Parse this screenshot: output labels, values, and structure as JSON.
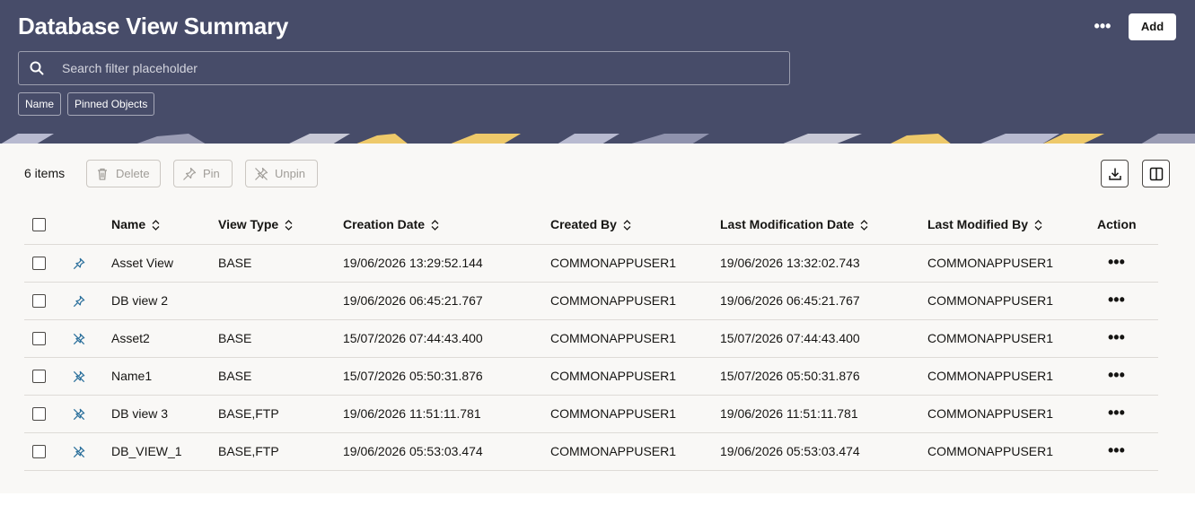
{
  "header": {
    "title": "Database View Summary",
    "more_label": "•••",
    "add_label": "Add",
    "search_placeholder": "Search filter placeholder",
    "chips": [
      "Name",
      "Pinned Objects"
    ]
  },
  "toolbar": {
    "items_count": "6 items",
    "delete_label": "Delete",
    "pin_label": "Pin",
    "unpin_label": "Unpin"
  },
  "table": {
    "columns": [
      "Name",
      "View Type",
      "Creation Date",
      "Created By",
      "Last Modification Date",
      "Last Modified By",
      "Action"
    ],
    "rows": [
      {
        "pin": "pinned",
        "name": "Asset View",
        "view_type": "BASE",
        "creation_date": "19/06/2026 13:29:52.144",
        "created_by": "COMMONAPPUSER1",
        "last_mod_date": "19/06/2026 13:32:02.743",
        "last_mod_by": "COMMONAPPUSER1",
        "action": "•••"
      },
      {
        "pin": "pinned",
        "name": "DB view 2",
        "view_type": "",
        "creation_date": "19/06/2026 06:45:21.767",
        "created_by": "COMMONAPPUSER1",
        "last_mod_date": "19/06/2026 06:45:21.767",
        "last_mod_by": "COMMONAPPUSER1",
        "action": "•••"
      },
      {
        "pin": "unpinned",
        "name": "Asset2",
        "view_type": "BASE",
        "creation_date": "15/07/2026 07:44:43.400",
        "created_by": "COMMONAPPUSER1",
        "last_mod_date": "15/07/2026 07:44:43.400",
        "last_mod_by": "COMMONAPPUSER1",
        "action": "•••"
      },
      {
        "pin": "unpinned",
        "name": "Name1",
        "view_type": "BASE",
        "creation_date": "15/07/2026 05:50:31.876",
        "created_by": "COMMONAPPUSER1",
        "last_mod_date": "15/07/2026 05:50:31.876",
        "last_mod_by": "COMMONAPPUSER1",
        "action": "•••"
      },
      {
        "pin": "unpinned",
        "name": "DB view 3",
        "view_type": "BASE,FTP",
        "creation_date": "19/06/2026 11:51:11.781",
        "created_by": "COMMONAPPUSER1",
        "last_mod_date": "19/06/2026 11:51:11.781",
        "last_mod_by": "COMMONAPPUSER1",
        "action": "•••"
      },
      {
        "pin": "unpinned",
        "name": "DB_VIEW_1",
        "view_type": "BASE,FTP",
        "creation_date": "19/06/2026 05:53:03.474",
        "created_by": "COMMONAPPUSER1",
        "last_mod_date": "19/06/2026 05:53:03.474",
        "last_mod_by": "COMMONAPPUSER1",
        "action": "•••"
      }
    ]
  },
  "colors": {
    "header_bg": "#474c69",
    "content_bg": "#f9f8f6",
    "pin_accent": "#2a6f9b"
  },
  "icons": {
    "search": "search-icon",
    "delete": "trash-icon",
    "pin": "pin-icon",
    "unpin": "unpin-icon",
    "download": "download-icon",
    "columns": "columns-icon"
  }
}
